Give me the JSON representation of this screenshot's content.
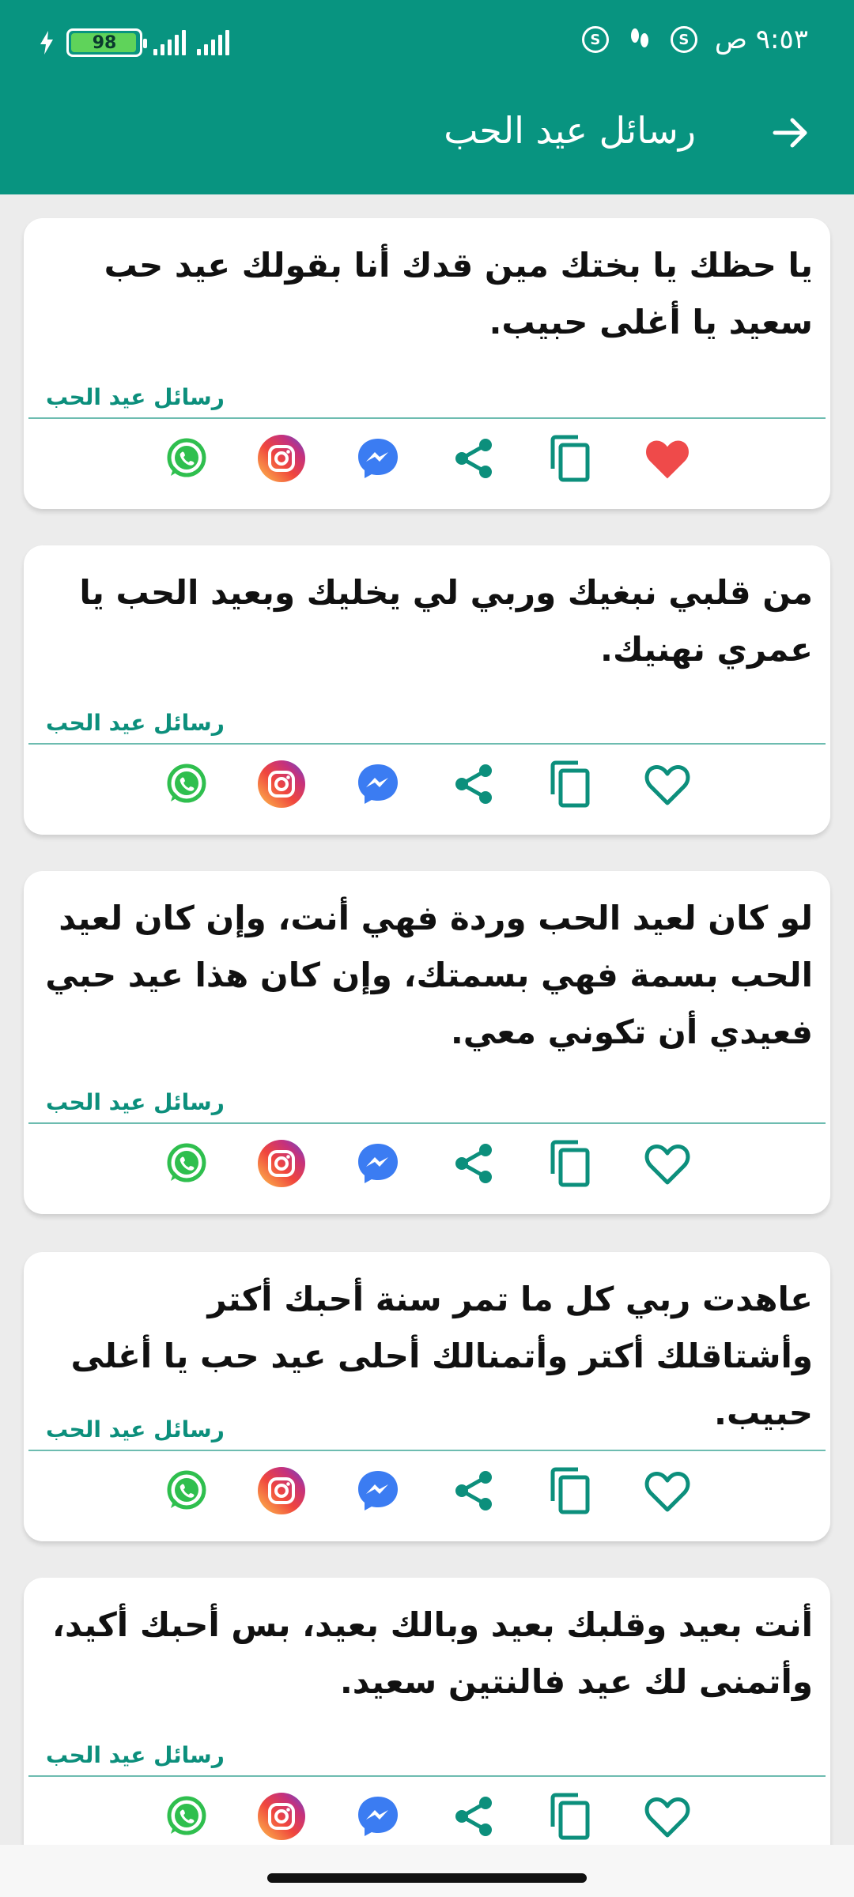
{
  "status_bar": {
    "battery_level": "98",
    "battery_fraction": 0.98,
    "time": "٩:٥٣ ص"
  },
  "toolbar": {
    "title": "رسائل عيد الحب"
  },
  "colors": {
    "primary": "#089480",
    "accent_text": "#0c8f7c",
    "favorite_active": "#ef4a4a"
  },
  "cards": [
    {
      "text": "يا حظك يا بختك مين قدك أنا بقولك عيد حب سعيد يا أغلى حبيب.",
      "source": "رسائل عيد الحب",
      "favorite": true
    },
    {
      "text": "من قلبي نبغيك وربي لي يخليك وبعيد الحب يا عمري نهنيك.",
      "source": "رسائل عيد الحب",
      "favorite": false
    },
    {
      "text": "لو كان لعيد الحب وردة فهي أنت، وإن كان لعيد الحب بسمة فهي بسمتك، وإن كان هذا عيد حبي فعيدي أن تكوني معي.",
      "source": "رسائل عيد الحب",
      "favorite": false
    },
    {
      "text": "عاهدت ربي كل ما تمر سنة أحبك أكتر وأشتاقلك أكتر وأتمنالك أحلى عيد حب يا أغلى حبيب.",
      "source": "رسائل عيد الحب",
      "favorite": false
    },
    {
      "text": "أنت بعيد وقلبك بعيد وبالك بعيد، بس أحبك أكيد، وأتمنى لك عيد فالنتين سعيد.",
      "source": "رسائل عيد الحب",
      "favorite": false
    }
  ],
  "icons": {
    "whatsapp": "whatsapp-icon",
    "instagram": "instagram-icon",
    "messenger": "messenger-icon",
    "share": "share-icon",
    "copy": "copy-icon",
    "favorite": "heart-icon"
  }
}
